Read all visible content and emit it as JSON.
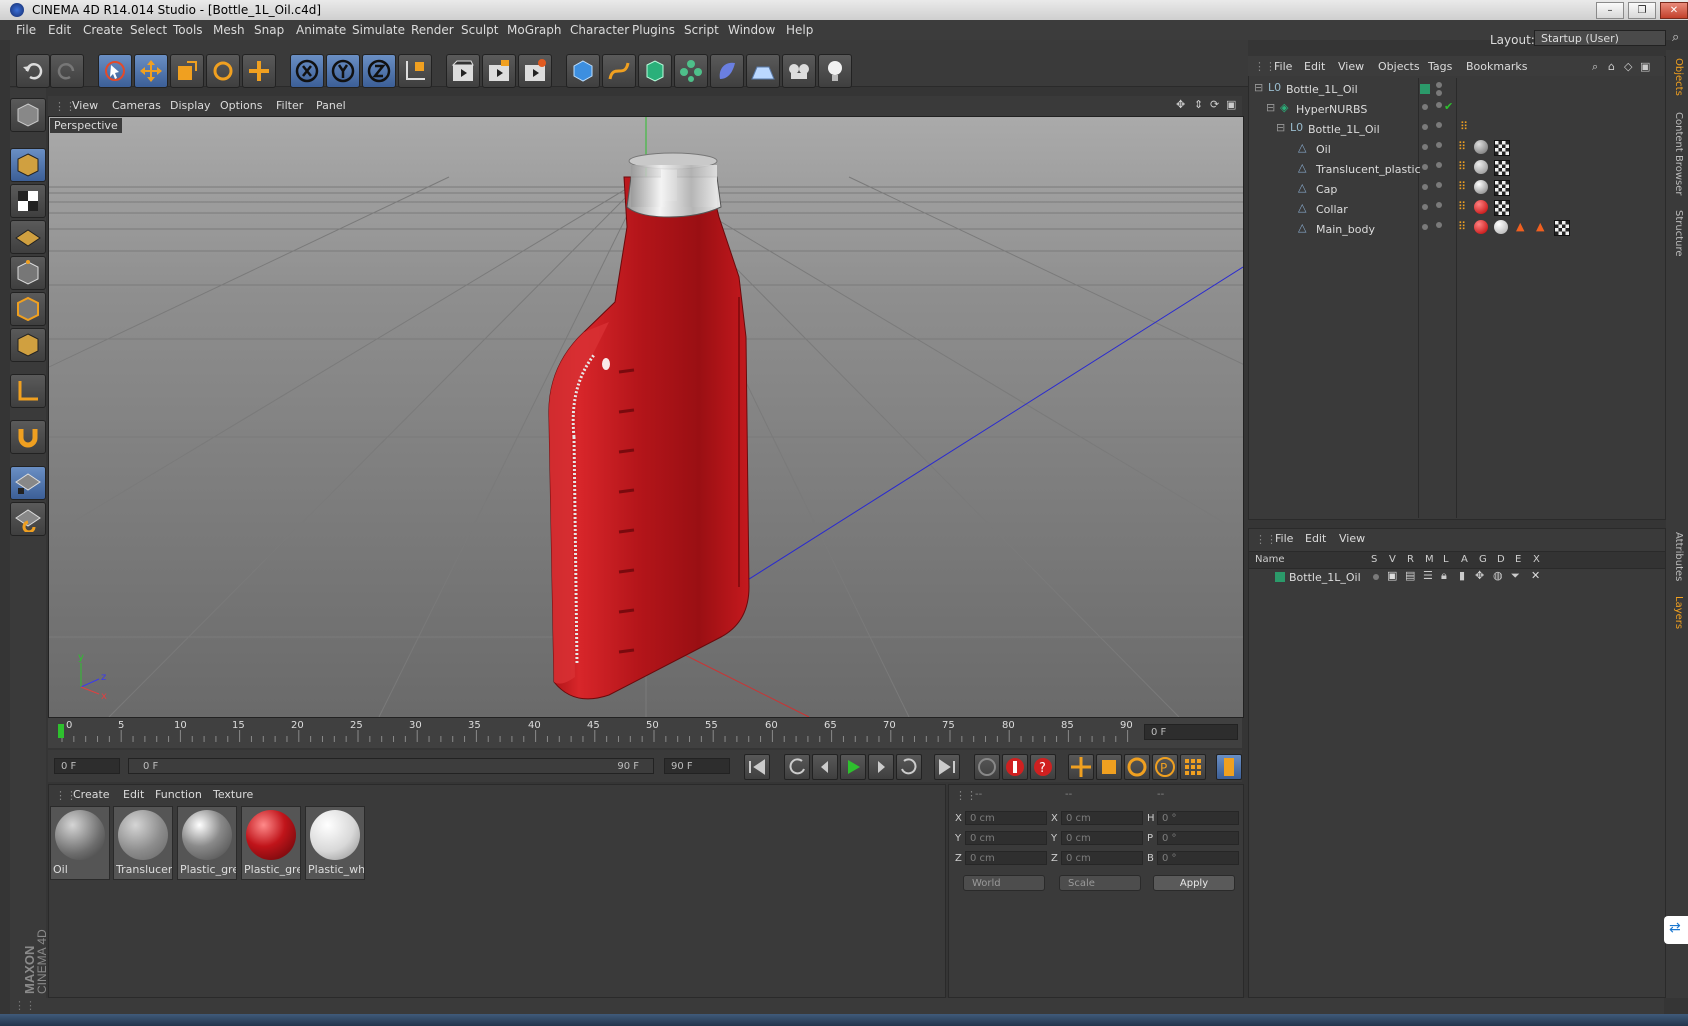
{
  "window": {
    "title": "CINEMA 4D R14.014 Studio - [Bottle_1L_Oil.c4d]",
    "min": "–",
    "max": "❐",
    "close": "✕"
  },
  "menubar": [
    "File",
    "Edit",
    "Create",
    "Select",
    "Tools",
    "Mesh",
    "Snap",
    "Animate",
    "Simulate",
    "Render",
    "Sculpt",
    "MoGraph",
    "Character",
    "Plugins",
    "Script",
    "Window",
    "Help"
  ],
  "layout": {
    "label": "Layout:",
    "value": "Startup (User)"
  },
  "viewport": {
    "menu": [
      "View",
      "Cameras",
      "Display",
      "Options",
      "Filter",
      "Panel"
    ],
    "camera": "Perspective",
    "axes": {
      "y": "y",
      "z": "z",
      "x": "x"
    }
  },
  "timeline": {
    "ticks": [
      "0",
      "5",
      "10",
      "15",
      "20",
      "25",
      "30",
      "35",
      "40",
      "45",
      "50",
      "55",
      "60",
      "65",
      "70",
      "75",
      "80",
      "85",
      "90"
    ],
    "current_frame": "0 F",
    "start_field": "0 F",
    "range_start": "0 F",
    "range_end": "90 F",
    "end_field": "90 F"
  },
  "materials": {
    "menu": [
      "Create",
      "Edit",
      "Function",
      "Texture"
    ],
    "items": [
      {
        "name": "Oil",
        "color": "#8a8a8a"
      },
      {
        "name": "Translucen",
        "color": "#9a9a9a"
      },
      {
        "name": "Plastic_gre",
        "color": "#7f7f7f"
      },
      {
        "name": "Plastic_gre",
        "color": "#c0141a"
      },
      {
        "name": "Plastic_whi",
        "color": "#d8d8d8"
      }
    ]
  },
  "coordinates": {
    "headers": [
      "--",
      "--",
      "--"
    ],
    "rows": [
      {
        "a": "X",
        "av": "0 cm",
        "b": "X",
        "bv": "0 cm",
        "c": "H",
        "cv": "0 °"
      },
      {
        "a": "Y",
        "av": "0 cm",
        "b": "Y",
        "bv": "0 cm",
        "c": "P",
        "cv": "0 °"
      },
      {
        "a": "Z",
        "av": "0 cm",
        "b": "Z",
        "bv": "0 cm",
        "c": "B",
        "cv": "0 °"
      }
    ],
    "mode": "World",
    "scale": "Scale",
    "apply": "Apply"
  },
  "objects": {
    "menu": [
      "File",
      "Edit",
      "View",
      "Objects",
      "Tags",
      "Bookmarks"
    ],
    "rows": [
      {
        "name": "Bottle_1L_Oil"
      },
      {
        "name": "HyperNURBS"
      },
      {
        "name": "Bottle_1L_Oil"
      },
      {
        "name": "Oil"
      },
      {
        "name": "Translucent_plastic"
      },
      {
        "name": "Cap"
      },
      {
        "name": "Collar"
      },
      {
        "name": "Main_body"
      }
    ]
  },
  "layers": {
    "menu": [
      "File",
      "Edit",
      "View"
    ],
    "header": [
      "Name",
      "S",
      "V",
      "R",
      "M",
      "L",
      "A",
      "G",
      "D",
      "E",
      "X"
    ],
    "row_name": "Bottle_1L_Oil"
  },
  "side_tabs": [
    "Objects",
    "Content Browser",
    "Structure",
    "Attributes",
    "Layers"
  ],
  "brand": "MAXON CINEMA 4D",
  "colors": {
    "accent": "#6a8fc4",
    "bottle": "#c81a1e",
    "layer": "#2b9a6a"
  }
}
